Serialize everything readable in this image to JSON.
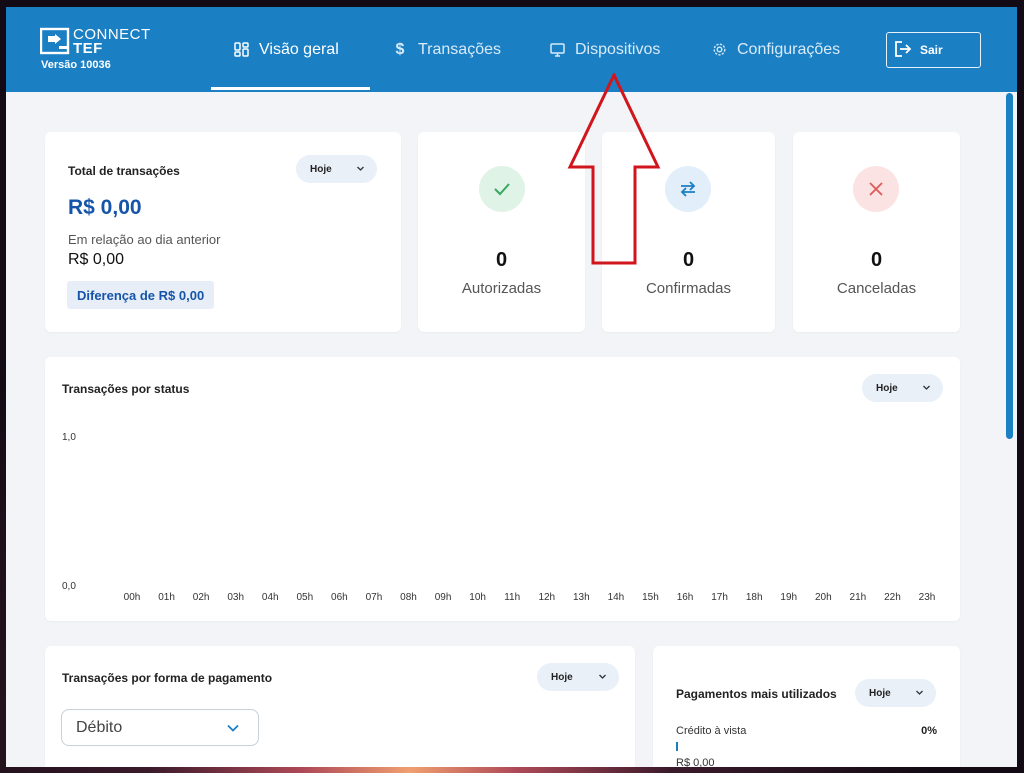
{
  "brand": {
    "name_line1": "CONNECT",
    "name_line2": "TEF",
    "version": "Versão 10036",
    "header_color": "#1b7fc4",
    "accent": "#1554a8"
  },
  "nav": {
    "items": [
      {
        "label": "Visão geral",
        "icon": "grid-icon",
        "active": true
      },
      {
        "label": "Transações",
        "icon": "dollar-icon",
        "active": false
      },
      {
        "label": "Dispositivos",
        "icon": "monitor-icon",
        "active": false
      },
      {
        "label": "Configurações",
        "icon": "gear-icon",
        "active": false
      }
    ],
    "logout_label": "Sair"
  },
  "total_card": {
    "title": "Total de transações",
    "period": "Hoje",
    "total_value": "R$  0,00",
    "compare_label": "Em relação ao dia anterior",
    "compare_value": "R$  0,00",
    "diff_label": "Diferença de R$  0,00"
  },
  "stats": [
    {
      "value": "0",
      "label": "Autorizadas",
      "icon": "check-icon",
      "icon_color": "#3aa860",
      "icon_bg": "#dff3e6"
    },
    {
      "value": "0",
      "label": "Confirmadas",
      "icon": "swap-arrows-icon",
      "icon_color": "#1b7fc4",
      "icon_bg": "#e2eef9"
    },
    {
      "value": "0",
      "label": "Canceladas",
      "icon": "close-icon",
      "icon_color": "#e05858",
      "icon_bg": "#fbe3e3"
    }
  ],
  "status_chart": {
    "title": "Transações por status",
    "period": "Hoje",
    "y_max_label": "1,0",
    "y_min_label": "0,0",
    "hours": [
      "00h",
      "01h",
      "02h",
      "03h",
      "04h",
      "05h",
      "06h",
      "07h",
      "08h",
      "09h",
      "10h",
      "11h",
      "12h",
      "13h",
      "14h",
      "15h",
      "16h",
      "17h",
      "18h",
      "19h",
      "20h",
      "21h",
      "22h",
      "23h"
    ]
  },
  "chart_data": {
    "type": "bar",
    "title": "Transações por status",
    "categories": [
      "00h",
      "01h",
      "02h",
      "03h",
      "04h",
      "05h",
      "06h",
      "07h",
      "08h",
      "09h",
      "10h",
      "11h",
      "12h",
      "13h",
      "14h",
      "15h",
      "16h",
      "17h",
      "18h",
      "19h",
      "20h",
      "21h",
      "22h",
      "23h"
    ],
    "values": [
      0,
      0,
      0,
      0,
      0,
      0,
      0,
      0,
      0,
      0,
      0,
      0,
      0,
      0,
      0,
      0,
      0,
      0,
      0,
      0,
      0,
      0,
      0,
      0
    ],
    "ylim": [
      0,
      1
    ],
    "grid": false
  },
  "payment_card": {
    "title": "Transações por forma de pagamento",
    "period": "Hoje",
    "selected_method": "Débito"
  },
  "top_payments": {
    "title": "Pagamentos mais utilizados",
    "period": "Hoje",
    "items": [
      {
        "label": "Crédito à vista",
        "percent": "0%",
        "fraction": 0,
        "amount": "R$  0,00"
      }
    ]
  },
  "annotation": {
    "arrow_color": "#d0161c"
  }
}
